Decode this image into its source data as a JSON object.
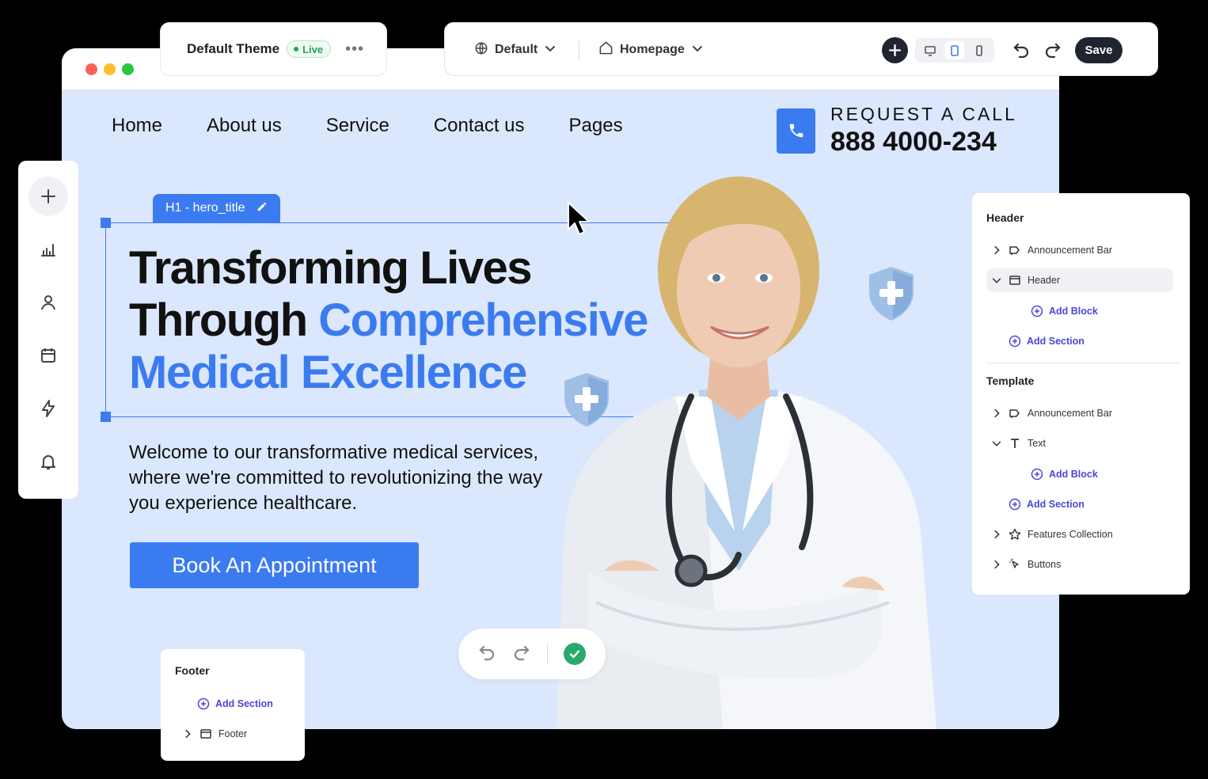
{
  "theme_card": {
    "name": "Default Theme",
    "status": "Live",
    "more": "•••"
  },
  "toolbar": {
    "locale": "Default",
    "page": "Homepage",
    "save_label": "Save",
    "icons": [
      "globe-icon",
      "home-icon",
      "plus-icon",
      "desktop-icon",
      "tablet-icon",
      "mobile-icon",
      "undo-icon",
      "redo-icon"
    ]
  },
  "site": {
    "nav": [
      "Home",
      "About us",
      "Service",
      "Contact us",
      "Pages"
    ],
    "call_label": "REQUEST A CALL",
    "call_number": "888 4000-234",
    "selection_tag": "H1 - hero_title",
    "hero_line1": "Transforming Lives",
    "hero_line2a": "Through ",
    "hero_line2b": "Comprehensive",
    "hero_line3": "Medical Excellence",
    "hero_subtitle": "Welcome to our transformative medical services, where we're committed to revolutionizing the way you experience healthcare.",
    "cta_label": "Book An Appointment"
  },
  "sidebar": {
    "icons": [
      "plus-icon",
      "analytics-icon",
      "user-icon",
      "calendar-icon",
      "lightning-icon",
      "bell-icon"
    ]
  },
  "panel": {
    "header_title": "Header",
    "header_items": [
      "Announcement Bar",
      "Header"
    ],
    "add_block": "Add Block",
    "add_section": "Add Section",
    "template_title": "Template",
    "template_items": [
      "Announcement Bar",
      "Text",
      "Features Collection",
      "Buttons"
    ]
  },
  "footer_card": {
    "title": "Footer",
    "add_section": "Add Section",
    "item": "Footer"
  },
  "colors": {
    "accent": "#3b7bf0",
    "page_bg": "#dbe7fd",
    "success": "#29a96b",
    "dark": "#1f2430",
    "link": "#4b47d6"
  }
}
